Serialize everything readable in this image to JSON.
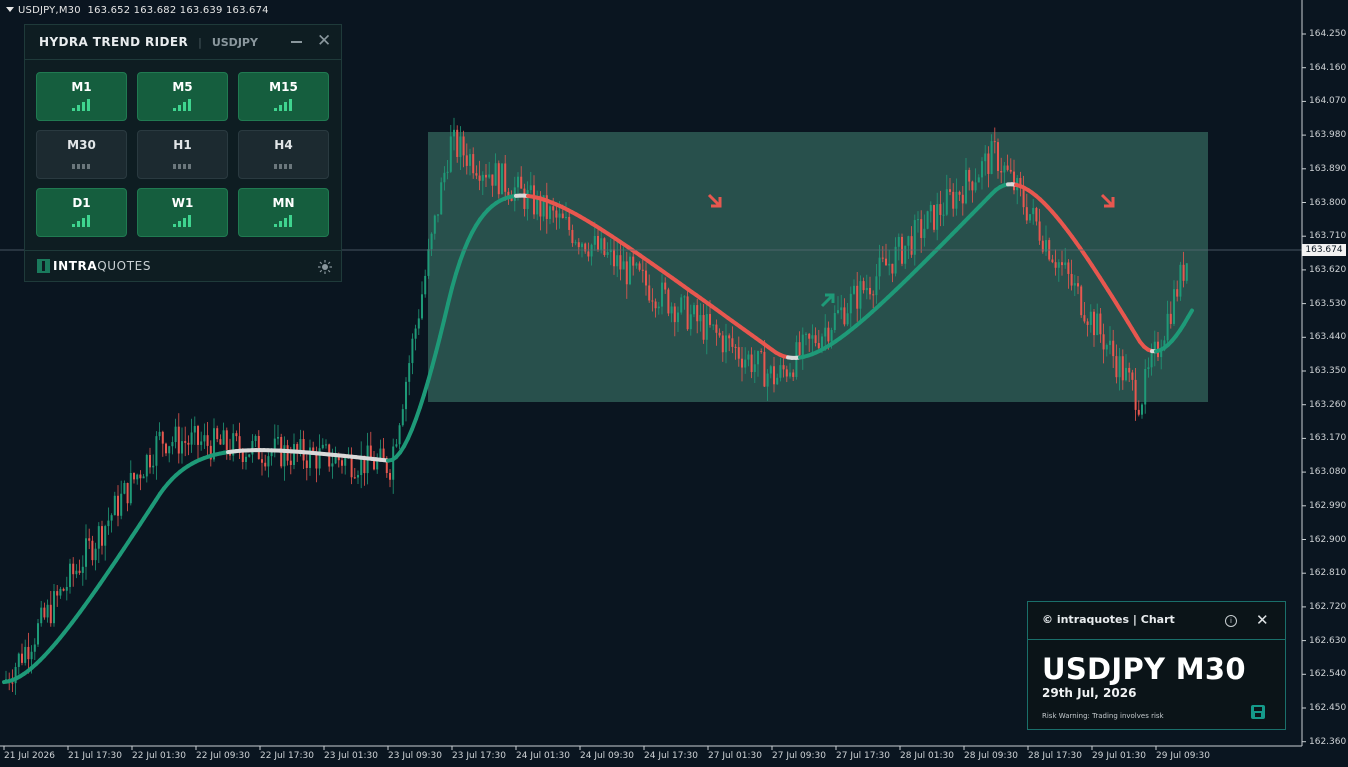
{
  "header": {
    "symbol_tf": "USDJPY,M30",
    "ohlc": "163.652 163.682 163.639 163.674"
  },
  "price_axis": [
    "164.250",
    "164.160",
    "164.070",
    "163.980",
    "163.890",
    "163.800",
    "163.710",
    "163.620",
    "163.530",
    "163.440",
    "163.350",
    "163.260",
    "163.170",
    "163.080",
    "162.990",
    "162.900",
    "162.810",
    "162.720",
    "162.630",
    "162.540",
    "162.450",
    "162.360"
  ],
  "current_price": "163.674",
  "time_axis": [
    "21 Jul 2026",
    "21 Jul 17:30",
    "22 Jul 01:30",
    "22 Jul 09:30",
    "22 Jul 17:30",
    "23 Jul 01:30",
    "23 Jul 09:30",
    "23 Jul 17:30",
    "24 Jul 01:30",
    "24 Jul 09:30",
    "24 Jul 17:30",
    "27 Jul 01:30",
    "27 Jul 09:30",
    "27 Jul 17:30",
    "28 Jul 01:30",
    "28 Jul 09:30",
    "28 Jul 17:30",
    "29 Jul 01:30",
    "29 Jul 09:30"
  ],
  "colors": {
    "background": "#0a1520",
    "bull": "#1e9a78",
    "bear": "#e8574f",
    "neutral": "#d9d9d9",
    "range_box": "#2e5b55"
  },
  "panel": {
    "title": "HYDRA TREND RIDER",
    "symbol": "USDJPY",
    "minimize_icon": "minus-icon",
    "close_icon": "close-icon",
    "timeframes": [
      {
        "label": "M1",
        "state": "bullish"
      },
      {
        "label": "M5",
        "state": "bullish"
      },
      {
        "label": "M15",
        "state": "bullish"
      },
      {
        "label": "M30",
        "state": "neutral"
      },
      {
        "label": "H1",
        "state": "neutral"
      },
      {
        "label": "H4",
        "state": "neutral"
      },
      {
        "label": "D1",
        "state": "bullish"
      },
      {
        "label": "W1",
        "state": "bullish"
      },
      {
        "label": "MN",
        "state": "bullish"
      }
    ],
    "brand_bold": "INTRA",
    "brand_light": "QUOTES",
    "theme_icon": "sun-icon"
  },
  "card": {
    "brand": "© intraquotes | Chart",
    "title": "USDJPY M30",
    "date": "29th Jul, 2026",
    "risk": "Risk Warning: Trading involves risk",
    "info_icon": "info-icon",
    "close_icon": "close-icon",
    "save_icon": "save-icon"
  },
  "chart_data": {
    "type": "candlestick",
    "symbol": "USDJPY",
    "timeframe": "M30",
    "ylim": [
      162.36,
      164.25
    ],
    "key_points": [
      {
        "label": "start",
        "price": 162.52
      },
      {
        "label": "22 Jul 01:30",
        "price": 163.17
      },
      {
        "label": "23 Jul 09:30",
        "price": 163.1
      },
      {
        "label": "23 Jul 17:30",
        "price": 163.96
      },
      {
        "label": "27 Jul 09:30",
        "price": 163.33
      },
      {
        "label": "28 Jul 09:30",
        "price": 163.93
      },
      {
        "label": "29 Jul 01:30",
        "price": 163.27
      },
      {
        "label": "last",
        "price": 163.674
      }
    ],
    "range_box": {
      "high": 163.99,
      "low": 163.27
    },
    "signals": [
      {
        "type": "sell",
        "time": "27 Jul 01:30"
      },
      {
        "type": "buy",
        "time": "27 Jul 17:30"
      },
      {
        "type": "sell",
        "time": "29 Jul 01:30"
      }
    ]
  }
}
